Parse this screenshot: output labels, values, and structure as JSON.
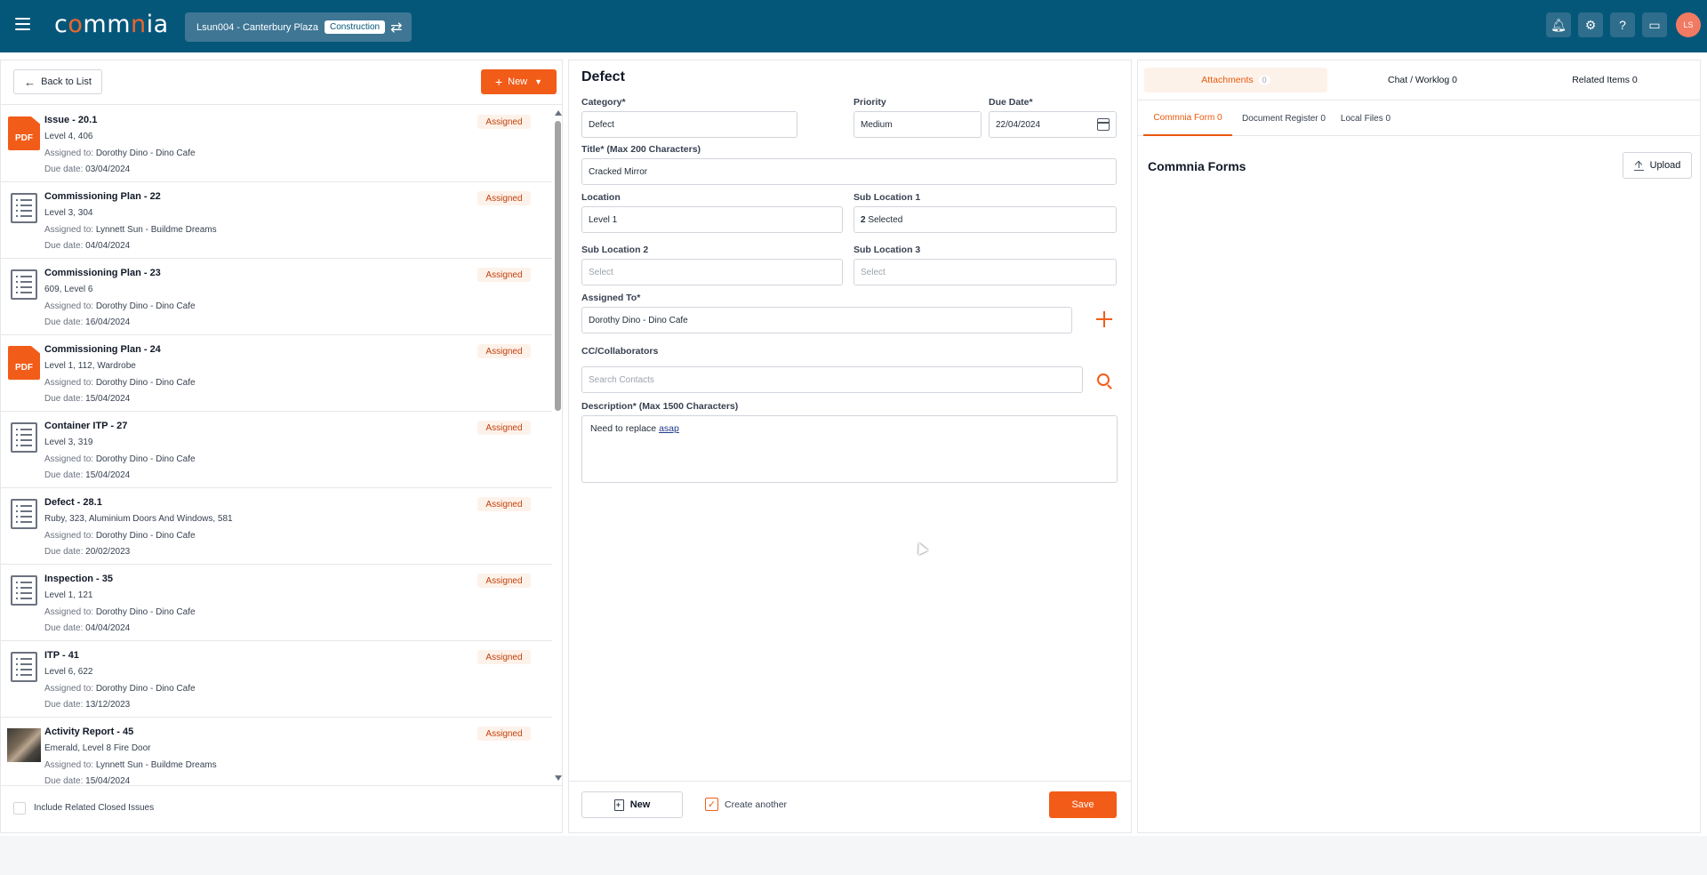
{
  "app": {
    "logo_text": "commnia",
    "project_name": "Lsun004 - Canterbury Plaza",
    "project_tag": "Construction",
    "user_initials": "LS"
  },
  "header_icons": [
    "bell-icon",
    "gear-icon",
    "help-icon",
    "chat-icon"
  ],
  "left": {
    "back_label": "Back to List",
    "new_label": "New",
    "include_closed_label": "Include Related Closed Issues",
    "assigned_prefix": "Assigned to:",
    "due_prefix": "Due date:",
    "items": [
      {
        "icon": "pdf",
        "title": "Issue - 20.1",
        "location": "Level 4, 406",
        "assigned_to": "Dorothy Dino - Dino Cafe",
        "due": "03/04/2024",
        "status": "Assigned"
      },
      {
        "icon": "list",
        "title": "Commissioning Plan - 22",
        "location": "Level 3, 304",
        "assigned_to": "Lynnett Sun - Buildme Dreams",
        "due": "04/04/2024",
        "status": "Assigned"
      },
      {
        "icon": "list",
        "title": "Commissioning Plan - 23",
        "location": "609, Level 6",
        "assigned_to": "Dorothy Dino - Dino Cafe",
        "due": "16/04/2024",
        "status": "Assigned"
      },
      {
        "icon": "pdf",
        "title": "Commissioning Plan - 24",
        "location": "Level 1, 112, Wardrobe",
        "assigned_to": "Dorothy Dino - Dino Cafe",
        "due": "15/04/2024",
        "status": "Assigned"
      },
      {
        "icon": "list",
        "title": "Container ITP - 27",
        "location": "Level 3, 319",
        "assigned_to": "Dorothy Dino - Dino Cafe",
        "due": "15/04/2024",
        "status": "Assigned"
      },
      {
        "icon": "list",
        "title": "Defect - 28.1",
        "location": "Ruby, 323, Aluminium Doors And Windows, 581",
        "assigned_to": "Dorothy Dino - Dino Cafe",
        "due": "20/02/2023",
        "status": "Assigned"
      },
      {
        "icon": "list",
        "title": "Inspection - 35",
        "location": "Level 1, 121",
        "assigned_to": "Dorothy Dino - Dino Cafe",
        "due": "04/04/2024",
        "status": "Assigned"
      },
      {
        "icon": "list",
        "title": "ITP - 41",
        "location": "Level 6, 622",
        "assigned_to": "Dorothy Dino - Dino Cafe",
        "due": "13/12/2023",
        "status": "Assigned"
      },
      {
        "icon": "photo",
        "title": "Activity Report - 45",
        "location": "Emerald, Level 8 Fire Door",
        "assigned_to": "Lynnett Sun - Buildme Dreams",
        "due": "15/04/2024",
        "status": "Assigned"
      }
    ]
  },
  "form": {
    "title": "Defect",
    "category_label": "Category*",
    "category_value": "Defect",
    "priority_label": "Priority",
    "priority_value": "Medium",
    "due_label": "Due Date*",
    "due_value": "22/04/2024",
    "title_label": "Title* (Max 200 Characters)",
    "title_value": "Cracked Mirror",
    "location_label": "Location",
    "location_value": "Level 1",
    "sub1_label": "Sub Location 1",
    "sub1_count": "2",
    "sub1_suffix": "Selected",
    "sub2_label": "Sub Location 2",
    "sub2_placeholder": "Select",
    "sub3_label": "Sub Location 3",
    "sub3_placeholder": "Select",
    "assigned_label": "Assigned To*",
    "assigned_value": "Dorothy Dino - Dino Cafe",
    "cc_label": "CC/Collaborators",
    "cc_placeholder": "Search Contacts",
    "desc_label": "Description* (Max 1500 Characters)",
    "desc_text": "Need to replace",
    "desc_underlined": "asap",
    "new_label": "New",
    "create_another_label": "Create another",
    "create_another_checked": true,
    "save_label": "Save"
  },
  "right": {
    "tabs": [
      {
        "label": "Attachments",
        "count": "0"
      },
      {
        "label": "Chat / Worklog 0"
      },
      {
        "label": "Related Items 0"
      }
    ],
    "subtabs": [
      "Commnia Form 0",
      "Document Register 0",
      "Local Files 0"
    ],
    "section_title": "Commnia Forms",
    "upload_label": "Upload"
  },
  "colors": {
    "header_bg": "#05577a",
    "accent": "#f25c19",
    "status_bg": "#fdf2ea"
  }
}
